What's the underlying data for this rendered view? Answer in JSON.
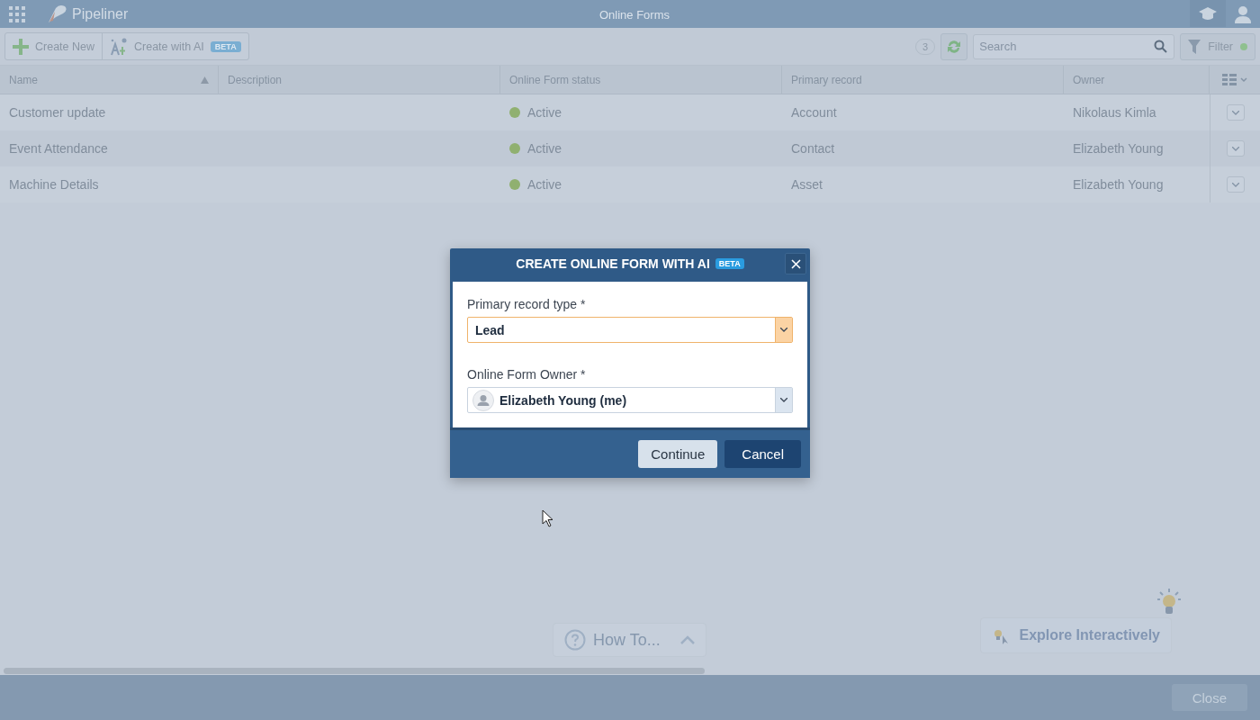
{
  "topbar": {
    "app_name": "Pipeliner",
    "title": "Online Forms"
  },
  "toolbar": {
    "create_new": "Create New",
    "create_ai": "Create with AI",
    "badge": "BETA",
    "count": "3",
    "search": {
      "placeholder": "Search"
    },
    "filter": {
      "label": "Filter",
      "active": true
    }
  },
  "table": {
    "columns": [
      {
        "label": "Name",
        "sorted": true
      },
      {
        "label": "Description",
        "sorted": false
      },
      {
        "label": "Online Form status",
        "sorted": false
      },
      {
        "label": "Primary record",
        "sorted": false
      },
      {
        "label": "Owner",
        "sorted": false
      }
    ],
    "rows": [
      {
        "name": "Customer update",
        "status": "Active",
        "color": "#90b070",
        "primary": "Account",
        "owner": "Nikolaus Kimla"
      },
      {
        "name": "Event Attendance",
        "status": "Active",
        "color": "#90b070",
        "primary": "Contact",
        "owner": "Elizabeth Young"
      },
      {
        "name": "Machine Details",
        "status": "Active",
        "color": "#90b070",
        "primary": "Asset",
        "owner": "Elizabeth Young"
      }
    ]
  },
  "dialog": {
    "title": "CREATE ONLINE FORM WITH AI",
    "badge": "BETA",
    "fields": [
      {
        "label": "Primary record type *",
        "value": "Lead",
        "kind": "select",
        "focused": true
      },
      {
        "label": "Online Form Owner *",
        "value": "Elizabeth Young (me)",
        "kind": "user",
        "focused": false
      }
    ],
    "buttons": [
      {
        "label": "Continue",
        "primary": false
      },
      {
        "label": "Cancel",
        "primary": true
      }
    ]
  },
  "help": {
    "how_to": "How To...",
    "explore": "Explore Interactively"
  },
  "footer": {
    "close": "Close"
  }
}
